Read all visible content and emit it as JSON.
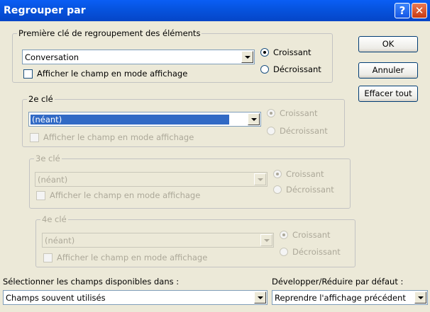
{
  "window": {
    "title": "Regrouper par",
    "help_glyph": "?",
    "close_glyph": "✕"
  },
  "key1": {
    "legend": "Première clé de regroupement des éléments",
    "value": "Conversation",
    "checkbox": "Afficher le champ en mode affichage",
    "asc": "Croissant",
    "desc": "Décroissant"
  },
  "key2": {
    "legend": "2e clé",
    "value": "(néant)",
    "checkbox": "Afficher le champ en mode affichage",
    "asc": "Croissant",
    "desc": "Décroissant"
  },
  "key3": {
    "legend": "3e clé",
    "value": "(néant)",
    "checkbox": "Afficher le champ en mode affichage",
    "asc": "Croissant",
    "desc": "Décroissant"
  },
  "key4": {
    "legend": "4e clé",
    "value": "(néant)",
    "checkbox": "Afficher le champ en mode affichage",
    "asc": "Croissant",
    "desc": "Décroissant"
  },
  "buttons": {
    "ok": "OK",
    "cancel": "Annuler",
    "clear": "Effacer tout"
  },
  "bottom": {
    "fields_label": "Sélectionner les champs disponibles dans :",
    "fields_value": "Champs souvent utilisés",
    "expand_label": "Développer/Réduire par défaut :",
    "expand_value": "Reprendre l'affichage précédent"
  }
}
